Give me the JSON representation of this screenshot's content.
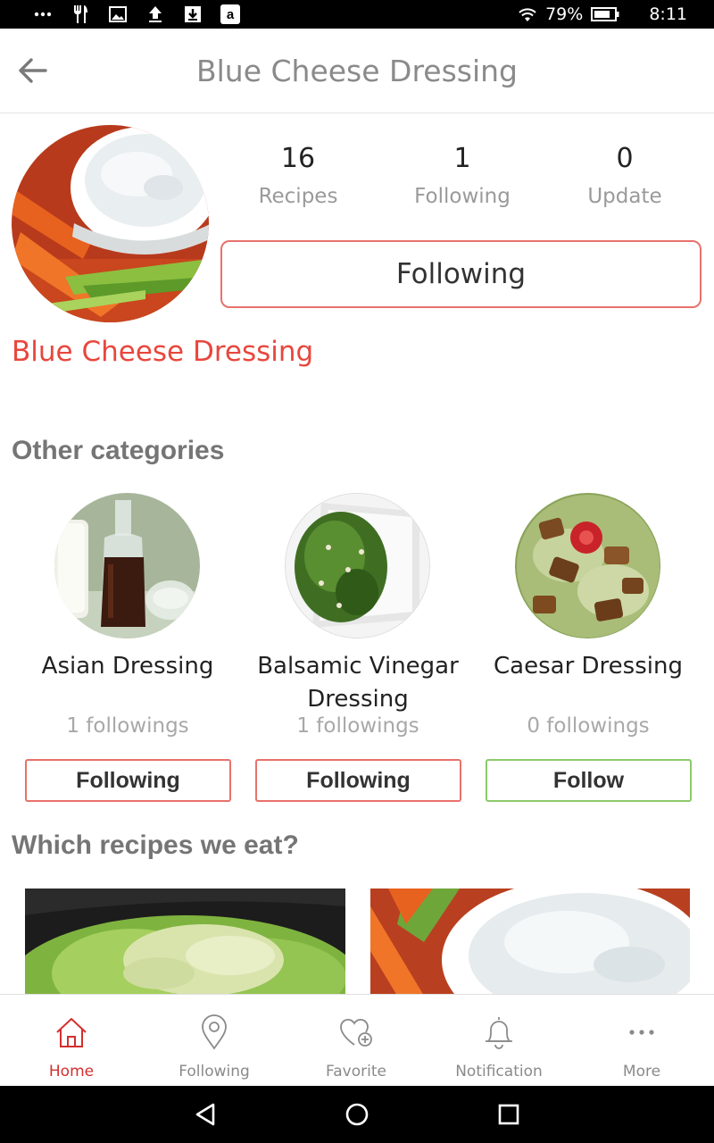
{
  "status_bar": {
    "battery": "79%",
    "time": "8:11",
    "left_icons": [
      "more-dots-icon",
      "utensils-icon",
      "image-icon",
      "upload-icon",
      "download-icon",
      "amazon-icon"
    ],
    "right_icons": [
      "wifi-icon",
      "battery-icon"
    ]
  },
  "header": {
    "title": "Blue Cheese Dressing",
    "back_icon": "arrow-left-icon"
  },
  "profile": {
    "name": "Blue Cheese Dressing",
    "stats": [
      {
        "value": "16",
        "label": "Recipes"
      },
      {
        "value": "1",
        "label": "Following"
      },
      {
        "value": "0",
        "label": "Update"
      }
    ],
    "follow_button": "Following"
  },
  "sections": {
    "other_categories": "Other categories",
    "which_recipes": "Which recipes we eat?"
  },
  "categories": [
    {
      "name": "Asian Dressing",
      "count": "1 followings",
      "button": "Following",
      "state": "following"
    },
    {
      "name": "Balsamic Vinegar Dressing",
      "count": "1 followings",
      "button": "Following",
      "state": "following"
    },
    {
      "name": "Caesar Dressing",
      "count": "0 followings",
      "button": "Follow",
      "state": "follow"
    }
  ],
  "bottom_nav": [
    {
      "label": "Home",
      "icon": "home-icon",
      "active": true
    },
    {
      "label": "Following",
      "icon": "location-pin-icon",
      "active": false
    },
    {
      "label": "Favorite",
      "icon": "heart-plus-icon",
      "active": false
    },
    {
      "label": "Notification",
      "icon": "bell-icon",
      "active": false
    },
    {
      "label": "More",
      "icon": "more-dots-icon",
      "active": false
    }
  ],
  "colors": {
    "accent_red": "#e8473d",
    "following_border": "#e8716b",
    "follow_border": "#8cc96a",
    "active_nav": "#d32f2f"
  }
}
